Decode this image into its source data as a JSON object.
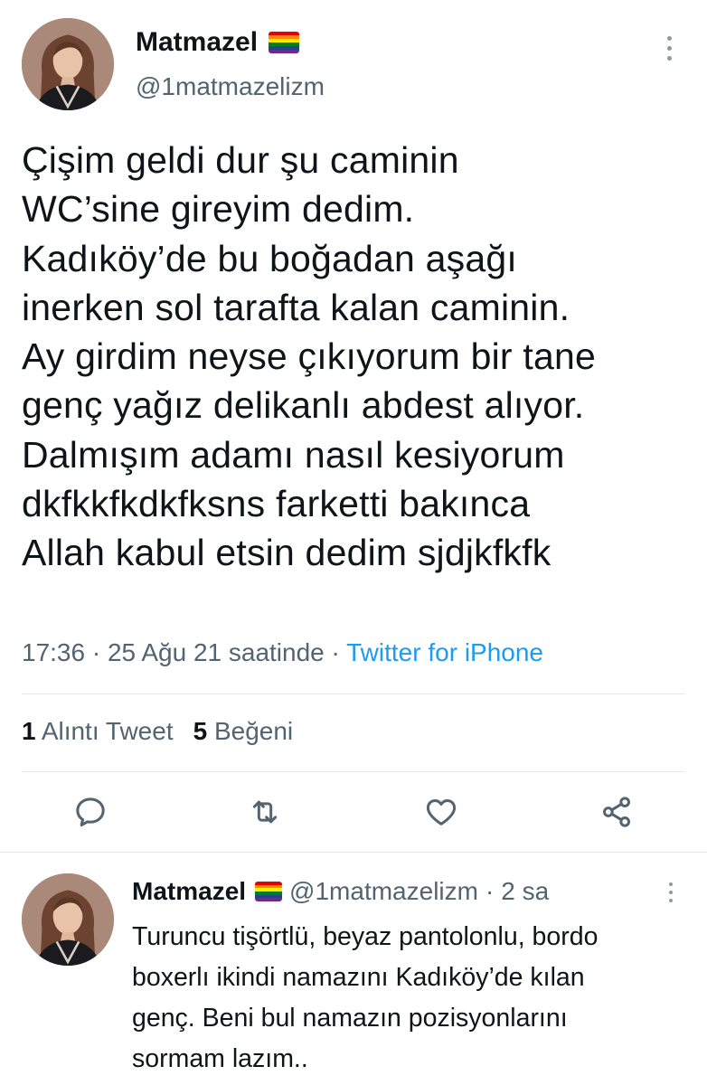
{
  "main_tweet": {
    "display_name": "Matmazel",
    "handle": "@1matmazelizm",
    "text_lines": [
      "Çişim geldi dur şu caminin",
      "WC’sine gireyim dedim.",
      "Kadıköy’de bu boğadan aşağı",
      "inerken sol tarafta kalan caminin.",
      "Ay girdim neyse çıkıyorum bir tane",
      "genç yağız delikanlı abdest alıyor.",
      "Dalmışım adamı nasıl kesiyorum",
      "dkfkkfkdkfksns farketti bakınca",
      "Allah kabul etsin dedim sjdjkfkfk"
    ],
    "time": "17:36",
    "date": "25 Ağu 21 saatinde",
    "source": "Twitter for iPhone",
    "separator": "·",
    "stats": {
      "quotes_count": "1",
      "quotes_label": "Alıntı Tweet",
      "likes_count": "5",
      "likes_label": "Beğeni"
    },
    "actions": [
      "reply-icon",
      "retweet-icon",
      "like-icon",
      "share-icon"
    ]
  },
  "reply_tweet": {
    "display_name": "Matmazel",
    "handle": "@1matmazelizm",
    "separator": "·",
    "time_ago": "2 sa",
    "text_lines": [
      "Turuncu tişörtlü, beyaz pantolonlu, bordo",
      "boxerlı ikindi namazını Kadıköy’de kılan",
      "genç. Beni bul namazın pozisyonlarını",
      "sormam lazım.."
    ]
  },
  "colors": {
    "text": "#0f1419",
    "secondary": "#536471",
    "link": "#1d9bf0",
    "divider": "#e6e9ec",
    "pride_flag": [
      "#e40303",
      "#ff8c00",
      "#ffed00",
      "#008026",
      "#24408e",
      "#732982"
    ]
  }
}
